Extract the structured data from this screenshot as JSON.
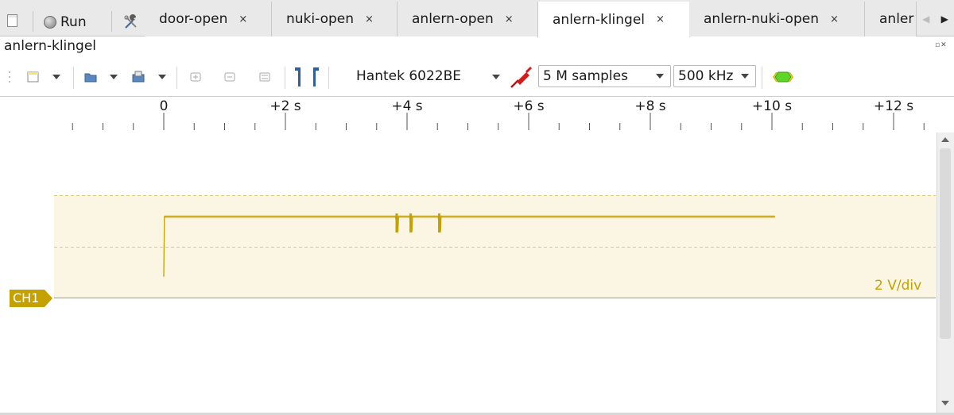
{
  "tabbar": {
    "run_label": "Run",
    "tabs": [
      {
        "label": "door-open",
        "close": "×"
      },
      {
        "label": "nuki-open",
        "close": "×"
      },
      {
        "label": "anlern-open",
        "close": "×"
      },
      {
        "label": "anlern-klingel",
        "close": "×",
        "active": true
      },
      {
        "label": "anlern-nuki-open",
        "close": "×"
      },
      {
        "label": "anler",
        "close": ""
      }
    ],
    "scroll_left_icon": "◀",
    "scroll_right_icon": "▶"
  },
  "session": {
    "title": "anlern-klingel",
    "dock_icons": "▫✕"
  },
  "toolbar": {
    "device": "Hantek 6022BE",
    "samples": "5 M samples",
    "sample_rate": "500 kHz",
    "icons": [
      "new-session-icon",
      "open-file-icon",
      "save-file-icon",
      "zoom-in-icon",
      "zoom-out-icon",
      "zoom-fit-icon",
      "cursor-icon",
      "probe-icon",
      "decoder-icon"
    ]
  },
  "ruler": {
    "labels": [
      "0",
      "+2 s",
      "+4 s",
      "+6 s",
      "+8 s",
      "+10 s",
      "+12 s"
    ]
  },
  "channel": {
    "name": "CH1",
    "scale": "2 V/div",
    "color": "#c4a000"
  },
  "chart_data": {
    "type": "line",
    "x_unit": "s",
    "series": [
      {
        "name": "CH1",
        "x": [
          -0.01,
          0.0,
          0.01,
          3.8,
          3.81,
          3.85,
          3.86,
          4.03,
          4.04,
          4.08,
          4.09,
          4.5,
          4.51,
          4.55,
          4.56,
          10.05
        ],
        "y": [
          -2.3,
          -2.3,
          0.0,
          0.0,
          0.0,
          -0.6,
          0.0,
          0.0,
          0.0,
          -0.6,
          0.0,
          0.0,
          0.0,
          -0.6,
          0.0,
          0.0
        ]
      }
    ],
    "x_range": [
      -2.7,
      12.5
    ],
    "scale_label": "2 V/div"
  }
}
